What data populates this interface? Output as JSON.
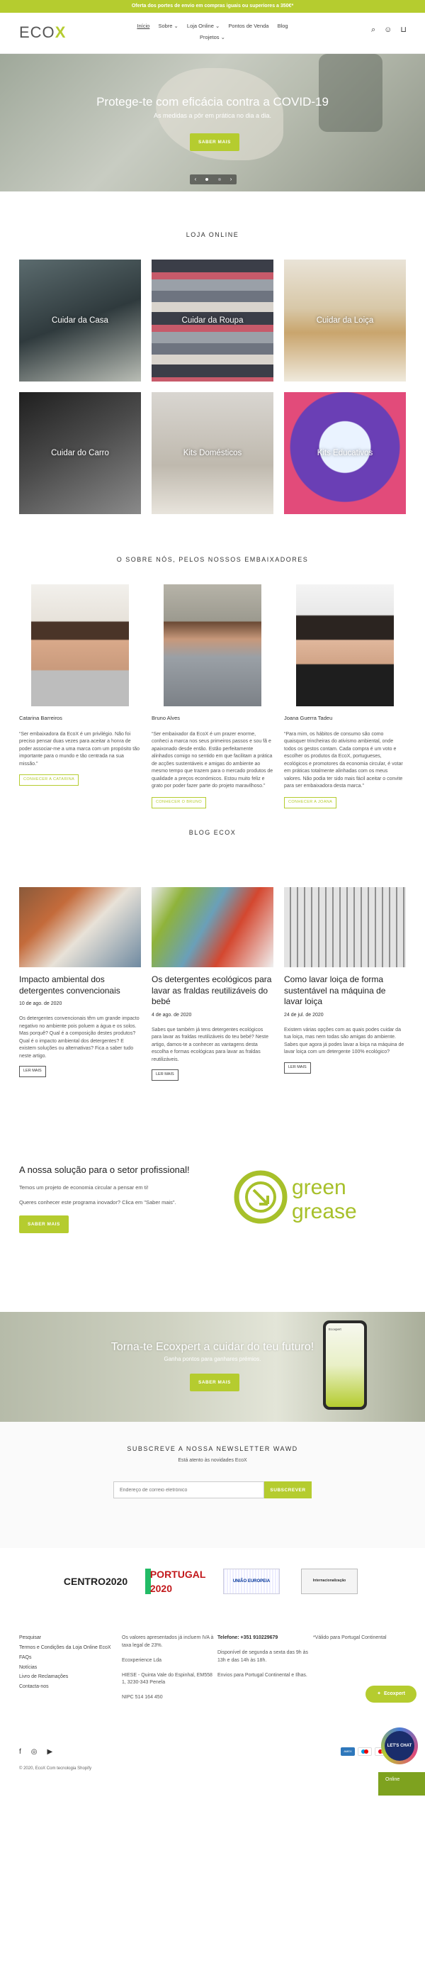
{
  "announcement": "Oferta dos portes de envio em compras iguais ou superiores a 350€*",
  "logo": {
    "text": "ECO",
    "x": "X"
  },
  "nav": {
    "items": [
      "Início",
      "Sobre ⌄",
      "Loja Online ⌄",
      "Pontos de Venda",
      "Blog"
    ],
    "second_row": "Projetos ⌄"
  },
  "header_icons": [
    "search-icon",
    "user-icon",
    "cart-icon"
  ],
  "hero": {
    "title": "Protege-te com eficácia contra a COVID-19",
    "subtitle": "As medidas a pôr em prática no dia a dia.",
    "button": "SABER MAIS",
    "prev": "‹",
    "next": "›"
  },
  "shop": {
    "title": "LOJA ONLINE",
    "categories": [
      "Cuidar da Casa",
      "Cuidar da Roupa",
      "Cuidar da Loiça",
      "Cuidar do Carro",
      "Kits Domésticos",
      "Kits Educativos"
    ]
  },
  "ambassadors": {
    "title": "O SOBRE NÓS, PELOS NOSSOS EMBAIXADORES",
    "people": [
      {
        "name": "Catarina Barreiros",
        "quote": "“Ser embaixadora da EcoX é um privilégio. Não foi preciso pensar duas vezes para aceitar a honra de poder associar-me a uma marca com um propósito tão importante para o mundo e tão centrada na sua missão.”",
        "button": "CONHECER A CATARINA"
      },
      {
        "name": "Bruno Alves",
        "quote": "“Ser embaixador da EcoX é um prazer enorme, conheci a marca nos seus primeiros passos e sou fã e apaixonado desde então. Estão perfeitamente alinhados comigo no sentido em que facilitam a prática de acções sustentáveis e amigas do ambiente ao mesmo tempo que trazem para o mercado produtos de qualidade a preços económicos. Estou muito feliz e grato por poder fazer parte do projeto maravilhoso.”",
        "button": "CONHECER O BRUNO"
      },
      {
        "name": "Joana Guerra Tadeu",
        "quote": "“Para mim, os hábitos de consumo são como quaisquer trincheiras do ativismo ambiental, onde todos os gestos contam. Cada compra é um voto e escolher os produtos da EcoX, portugueses, ecológicos e promotores da economia circular, é votar em práticas totalmente alinhadas com os meus valores. Não podia ter sido mais fácil aceitar o convite para ser embaixadora desta marca.”",
        "button": "CONHECER A JOANA"
      }
    ]
  },
  "blog": {
    "title": "BLOG ECOX",
    "posts": [
      {
        "title": "Impacto ambiental dos detergentes convencionais",
        "date": "10 de ago. de 2020",
        "excerpt": "Os detergentes convencionais têm um grande impacto negativo no ambiente pois poluem a água e os solos. Mas porquê? Qual é a composição destes produtos? Qual é o impacto ambiental dos detergentes? E existem soluções ou alternativas? Fica a saber tudo neste artigo.",
        "button": "LER MAIS"
      },
      {
        "title": "Os detergentes ecológicos para lavar as fraldas reutilizáveis do bebé",
        "date": "4 de ago. de 2020",
        "excerpt": "Sabes que também já tens detergentes ecológicos para lavar as fraldas reutilizáveis do teu bebé? Neste artigo, damos-te a conhecer as vantagens desta escolha e formas ecológicas para lavar as fraldas reutilizáveis.",
        "button": "LER MAIS"
      },
      {
        "title": "Como lavar loiça de forma sustentável na máquina de lavar loiça",
        "date": "24 de jul. de 2020",
        "excerpt": "Existem várias opções com as quais podes cuidar da tua loiça, mas nem todas são amigas do ambiente. Sabes que agora já podes lavar a loiça na máquina de lavar loiça com um detergente 100% ecológico?",
        "button": "LER MAIS"
      }
    ]
  },
  "professional": {
    "title": "A nossa solução para o setor profissional!",
    "p1": "Temos um projeto de economia circular a pensar em ti!",
    "p2": "Queres conhecer este programa inovador? Clica em \"Saber mais\".",
    "button": "SABER MAIS",
    "logo_line1": "green",
    "logo_line2": "grease"
  },
  "ecoxpert": {
    "title": "Torna-te Ecoxpert a cuidar do teu futuro!",
    "subtitle": "Ganha pontos para ganhares prémios.",
    "button": "SABER MAIS",
    "phone_text": "Ecoxpert"
  },
  "newsletter": {
    "title": "SUBSCREVE A NOSSA NEWSLETTER WAWD",
    "subtitle": "Está atento às novidades EcoX",
    "placeholder": "Endereço de correio eletrónico",
    "button": "SUBSCREVER"
  },
  "partner_logos": [
    "CENTRO2020",
    "PORTUGAL 2020",
    "UNIÃO EUROPEIA",
    "Internacionalização"
  ],
  "footer": {
    "links": [
      "Pesquisar",
      "Termos e Condições da Loja Online EcoX",
      "FAQs",
      "Notícias",
      "Livro de Reclamações",
      "Contacta-nos"
    ],
    "col2": [
      "Os valores apresentados já incluem IVA à taxa legal de 23%.",
      "Ecoxperience Lda",
      "HIESE - Quinta Vale do Espinhal, EM558 1, 3230-343 Penela",
      "NIPC 514 164 450"
    ],
    "col3": [
      "Telefone: +351 910229679",
      "Disponível de segunda a sexta das 9h às 13h e das 14h às 18h.",
      "Envios para Portugal Continental e Ilhas."
    ],
    "col4": [
      "*Válido para Portugal Continental"
    ]
  },
  "social": [
    "facebook-icon",
    "instagram-icon",
    "youtube-icon"
  ],
  "copyright": "© 2020, EcoX Com tecnologia Shopify",
  "widgets": {
    "ecoxpert": "Ecoxpert",
    "chat": "LET'S CHAT",
    "online": "Online"
  }
}
